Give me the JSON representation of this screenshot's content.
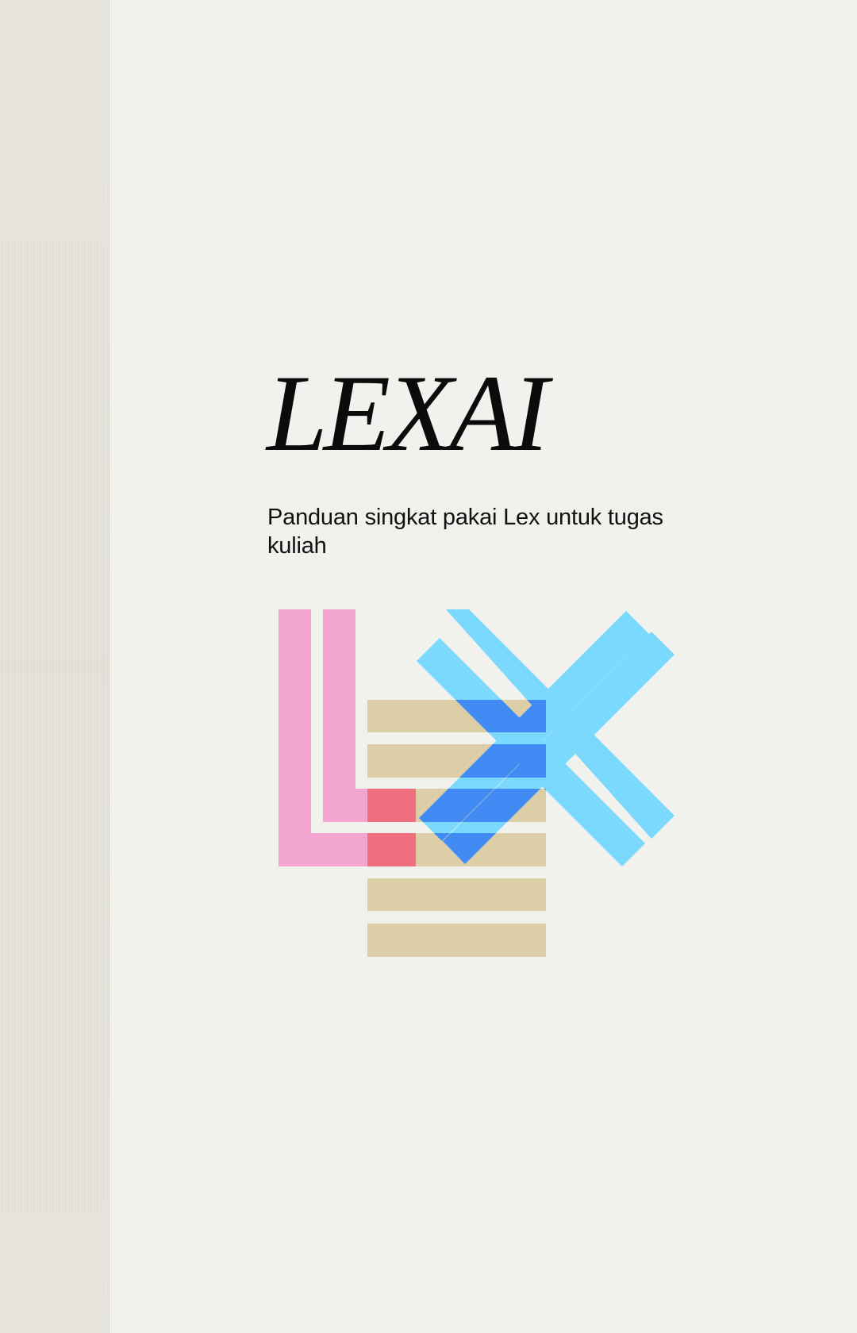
{
  "cover": {
    "title": "LEXAI",
    "subtitle": "Panduan singkat pakai Lex untuk tugas kuliah"
  },
  "logo": {
    "letters": "LX",
    "colors": {
      "l_pink": "#f3a6d0",
      "stripes_tan": "#dccfa8",
      "overlap_red": "#ef6f80",
      "x_light_blue": "#7bd9ff",
      "overlap_blue": "#438bf4"
    }
  },
  "colors": {
    "page_background": "#f1f1ed",
    "spine_background": "#e4e2d9",
    "title_text": "#0b0b0b",
    "subtitle_text": "#111111"
  }
}
